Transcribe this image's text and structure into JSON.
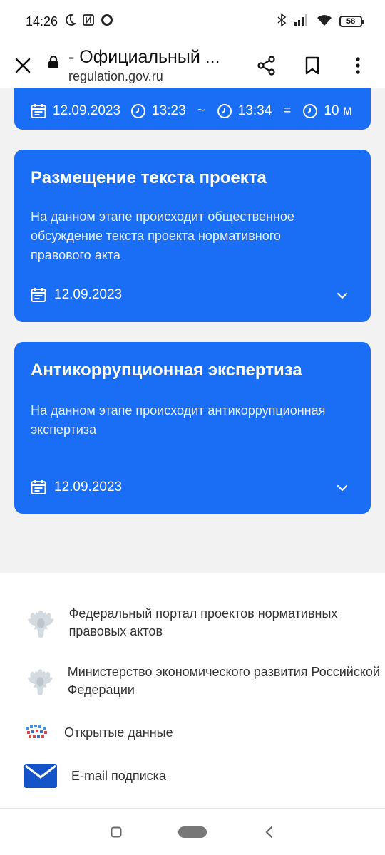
{
  "status_bar": {
    "time": "14:26",
    "battery": "58",
    "icons": [
      "moon-icon",
      "nfc-icon",
      "circle-icon",
      "bluetooth-icon",
      "signal-icon",
      "wifi-icon",
      "battery-icon"
    ]
  },
  "browser": {
    "title": "- Официальный ...",
    "url": "regulation.gov.ru",
    "icons": [
      "close-icon",
      "lock-icon",
      "share-icon",
      "bookmark-icon",
      "more-icon"
    ]
  },
  "cards": [
    {
      "date": "12.09.2023",
      "start_time": "13:23",
      "tilde": "~",
      "end_time": "13:34",
      "equals": "=",
      "duration": "10 м"
    },
    {
      "title": "Размещение текста проекта",
      "description": "На данном этапе происходит общественное обсуждение текста проекта нормативного правового акта",
      "date": "12.09.2023"
    },
    {
      "title": "Антикоррупционная экспертиза",
      "description": "На данном этапе происходит антикоррупционная экспертиза",
      "date": "12.09.2023"
    }
  ],
  "footer": {
    "items": [
      {
        "label": "Федеральный портал проектов нормативных правовых актов",
        "icon": "emblem-icon"
      },
      {
        "label": "Министерство экономического развития Российской Федерации",
        "icon": "emblem-icon"
      },
      {
        "label": "Открытые данные",
        "icon": "open-data-icon"
      },
      {
        "label": "E-mail подписка",
        "icon": "mail-icon"
      }
    ]
  },
  "colors": {
    "card_blue": "#1a6ef5",
    "background_gray": "#f2f2f2",
    "mail_blue": "#1554c8"
  }
}
